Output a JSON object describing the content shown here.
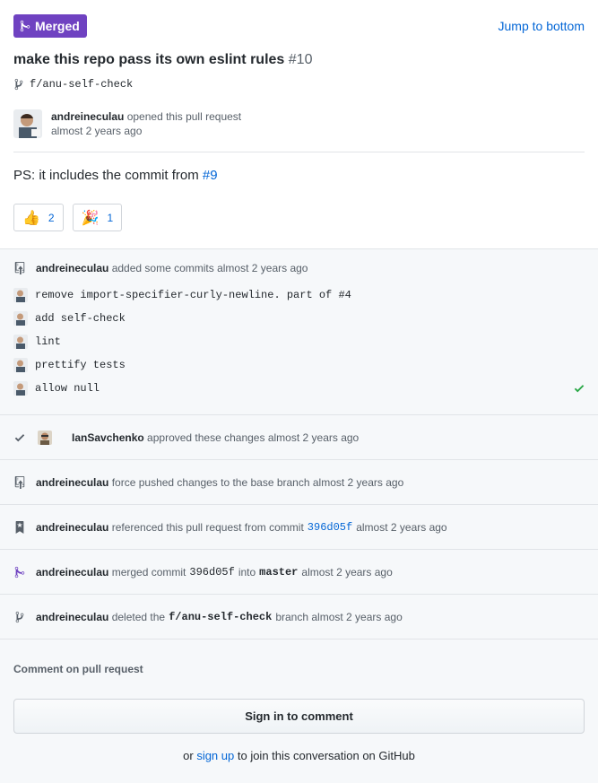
{
  "header": {
    "badge_label": "Merged",
    "jump_link": "Jump to bottom",
    "title": "make this repo pass its own eslint rules",
    "number": "#10",
    "branch": "f/anu-self-check"
  },
  "opener": {
    "user": "andreineculau",
    "action": "opened this pull request",
    "time": "almost 2 years ago"
  },
  "body": {
    "text_prefix": "PS: it includes the commit from",
    "link": "#9"
  },
  "reactions": [
    {
      "emoji": "👍",
      "count": "2"
    },
    {
      "emoji": "🎉",
      "count": "1"
    }
  ],
  "commits_block": {
    "user": "andreineculau",
    "action": "added some commits",
    "time": "almost 2 years ago",
    "commits": [
      "remove import-specifier-curly-newline. part of #4",
      "add self-check",
      "lint",
      "prettify tests",
      "allow null"
    ]
  },
  "events": {
    "approved": {
      "user": "IanSavchenko",
      "action": "approved these changes",
      "time": "almost 2 years ago"
    },
    "force_pushed": {
      "user": "andreineculau",
      "action": "force pushed changes to the base branch",
      "time": "almost 2 years ago"
    },
    "referenced": {
      "user": "andreineculau",
      "action": "referenced this pull request from commit",
      "sha": "396d05f",
      "time": "almost 2 years ago"
    },
    "merged": {
      "user": "andreineculau",
      "action": "merged commit",
      "sha": "396d05f",
      "into": "into",
      "branch": "master",
      "time": "almost 2 years ago"
    },
    "deleted": {
      "user": "andreineculau",
      "action": "deleted the",
      "branch": "f/anu-self-check",
      "suffix": "branch",
      "time": "almost 2 years ago"
    }
  },
  "comment": {
    "label": "Comment on pull request",
    "signin_button": "Sign in to comment",
    "or": "or",
    "signup_link": "sign up",
    "signup_suffix": "to join this conversation on GitHub"
  },
  "colors": {
    "merged_purple": "#6f42c1",
    "link_blue": "#0366d6",
    "success_green": "#28a745"
  }
}
